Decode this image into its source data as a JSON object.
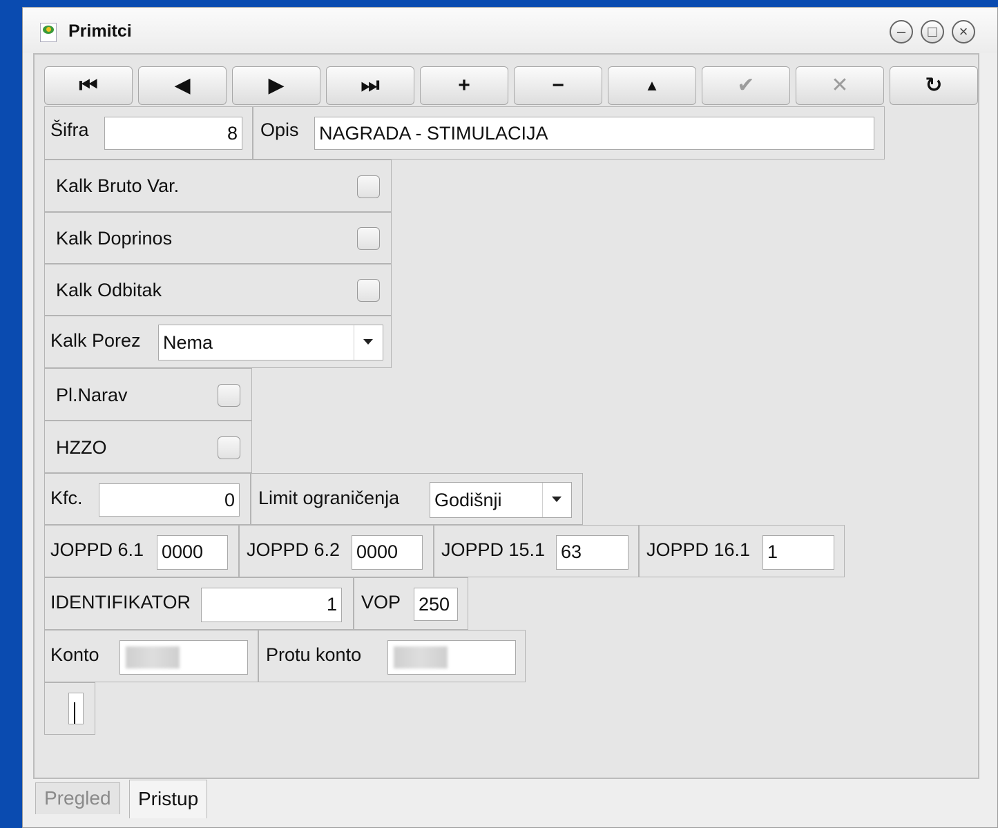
{
  "window": {
    "title": "Primitci"
  },
  "toolbar": {
    "first_icon": "⏮",
    "prev_icon": "◀",
    "next_icon": "▶",
    "last_icon": "⏭",
    "add_icon": "+",
    "delete_icon": "−",
    "edit_icon": "▲",
    "confirm_icon": "✔",
    "cancel_icon": "✕",
    "refresh_icon": "↻"
  },
  "form": {
    "sifra_label": "Šifra",
    "sifra_value": "8",
    "opis_label": "Opis",
    "opis_value": "NAGRADA - STIMULACIJA",
    "kalk_bruto_label": "Kalk Bruto Var.",
    "kalk_bruto_checked": false,
    "kalk_doprinos_label": "Kalk Doprinos",
    "kalk_doprinos_checked": false,
    "kalk_odbitak_label": "Kalk Odbitak",
    "kalk_odbitak_checked": false,
    "kalk_porez_label": "Kalk Porez",
    "kalk_porez_value": "Nema",
    "pl_narav_label": "Pl.Narav",
    "pl_narav_checked": false,
    "hzzo_label": "HZZO",
    "hzzo_checked": false,
    "kfc_label": "Kfc.",
    "kfc_value": "0",
    "limit_label": "Limit ograničenja",
    "limit_value": "Godišnji",
    "joppd61_label": "JOPPD 6.1",
    "joppd61_value": "0000",
    "joppd62_label": "JOPPD 6.2",
    "joppd62_value": "0000",
    "joppd151_label": "JOPPD 15.1",
    "joppd151_value": "63",
    "joppd161_label": "JOPPD 16.1",
    "joppd161_value": "1",
    "identifikator_label": "IDENTIFIKATOR",
    "identifikator_value": "1",
    "vop_label": "VOP",
    "vop_value": "250",
    "konto_label": "Konto",
    "protu_konto_label": "Protu konto"
  },
  "tabs": {
    "pregled": "Pregled",
    "pristup": "Pristup",
    "active": "Pristup"
  }
}
